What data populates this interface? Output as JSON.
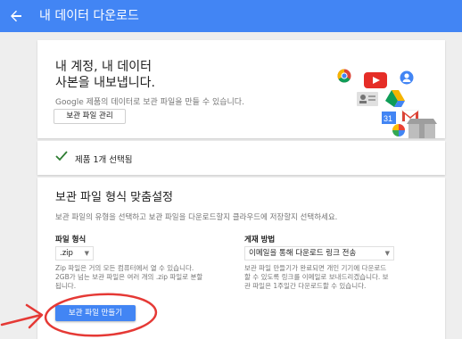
{
  "appbar": {
    "title": "내 데이터 다운로드",
    "back_icon": "arrow-left-icon",
    "color": "#4285f4"
  },
  "hero": {
    "title_line1": "내 계정, 내 데이터",
    "title_line2": "사본을 내보냅니다.",
    "description": "Google 제품의 데이터로 보관 파일을 만들 수 있습니다.",
    "manage_button": "보관 파일 관리",
    "icons": [
      "chrome-icon",
      "youtube-icon",
      "google-plus-icon",
      "contacts-icon",
      "drive-icon",
      "calendar-icon",
      "gmail-icon",
      "photos-icon",
      "archive-box-icon"
    ]
  },
  "selection": {
    "text": "제품 1개 선택됨",
    "icon": "check-icon"
  },
  "format": {
    "title": "보관 파일 형식 맞춤설정",
    "description": "보관 파일의 유형을 선택하고 보관 파일을 다운로드할지 클라우드에 저장할지 선택하세요.",
    "file_type_label": "파일 형식",
    "file_type_value": ".zip",
    "file_type_help": [
      "Zip 파일은 거의 모든 컴퓨터에서 열 수 있습니다.",
      "2GB가 넘는 보관 파일은 여러 개의 .zip 파일로 분할",
      "됩니다."
    ],
    "delivery_label": "게재 방법",
    "delivery_value": "이메일을 통해 다운로드 링크 전송",
    "delivery_help": [
      "보관 파일 만들기가 완료되면 개인 기기에 다운로드",
      "할 수 있도록 링크를 이메일로 보내드리겠습니다. 보",
      "관 파일은 1주일간 다운로드할 수 있습니다."
    ],
    "create_button": "보관 파일 만들기"
  },
  "annotation": {
    "color": "#e53935"
  }
}
